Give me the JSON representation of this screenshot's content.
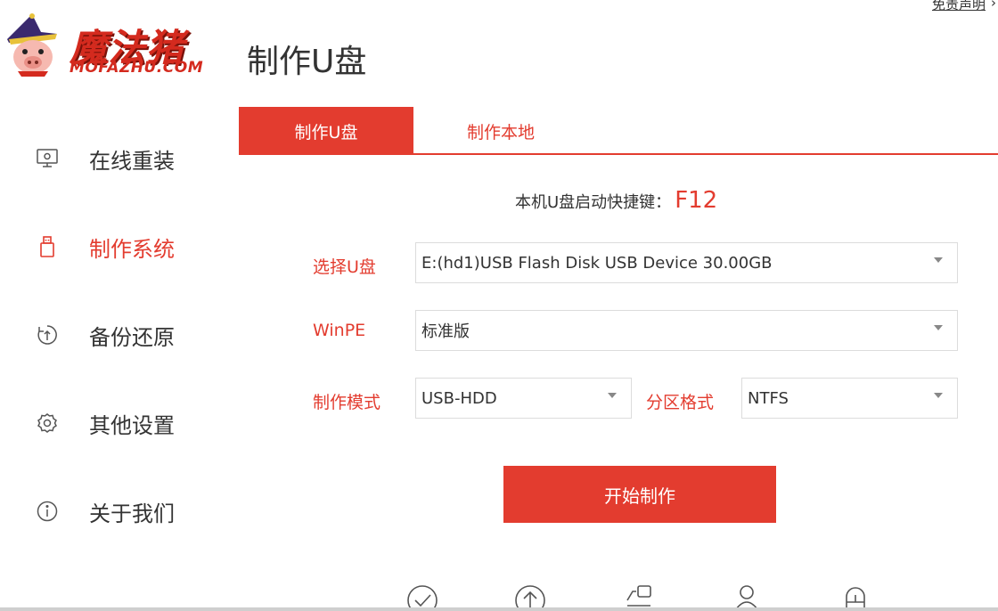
{
  "header": {
    "disclaimer": "免责声明",
    "logo_text": "魔法猪",
    "logo_sub": "MOFAZHU.COM",
    "page_title": "制作U盘"
  },
  "sidebar": {
    "items": [
      {
        "label": "在线重装",
        "icon": "monitor-icon",
        "active": false
      },
      {
        "label": "制作系统",
        "icon": "usb-drive-icon",
        "active": true
      },
      {
        "label": "备份还原",
        "icon": "restore-icon",
        "active": false
      },
      {
        "label": "其他设置",
        "icon": "gear-icon",
        "active": false
      },
      {
        "label": "关于我们",
        "icon": "info-icon",
        "active": false
      }
    ]
  },
  "tabs": [
    {
      "label": "制作U盘",
      "active": true
    },
    {
      "label": "制作本地",
      "active": false
    }
  ],
  "shortcut": {
    "label": "本机U盘启动快捷键：",
    "key": "F12"
  },
  "form": {
    "usb_label": "选择U盘",
    "usb_value": "E:(hd1)USB Flash Disk USB Device 30.00GB",
    "winpe_label": "WinPE",
    "winpe_value": "标准版",
    "mode_label": "制作模式",
    "mode_value": "USB-HDD",
    "partition_label": "分区格式",
    "partition_value": "NTFS"
  },
  "start_button": "开始制作",
  "bottom_icons": [
    "check-circle-icon",
    "upload-circle-icon",
    "device-icon",
    "user-icon",
    "lock-icon"
  ],
  "colors": {
    "accent": "#e33c2f",
    "text": "#333333"
  }
}
